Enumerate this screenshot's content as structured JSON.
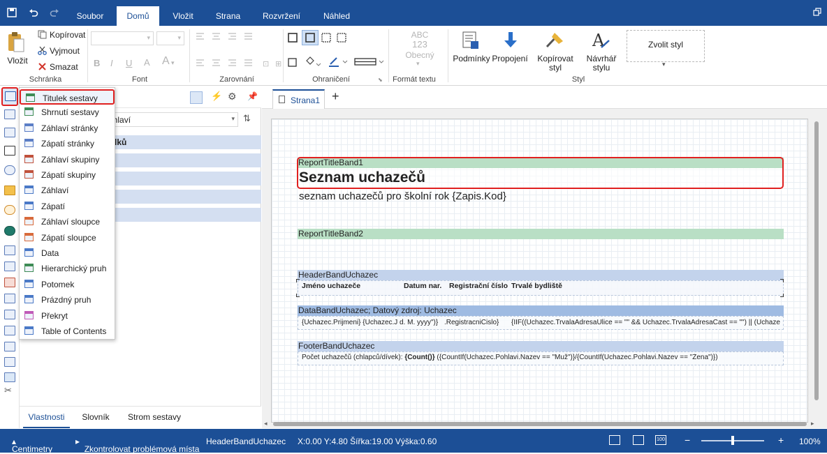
{
  "window": {
    "tabs": [
      "Soubor",
      "Domů",
      "Vložit",
      "Strana",
      "Rozvržení",
      "Náhled"
    ],
    "active_tab": "Domů"
  },
  "ribbon": {
    "clipboard": {
      "paste": "Vložit",
      "copy": "Kopírovat",
      "cut": "Vyjmout",
      "delete": "Smazat",
      "label": "Schránka"
    },
    "font": {
      "label": "Font"
    },
    "alignment": {
      "label": "Zarovnání"
    },
    "borders": {
      "label": "Ohraničení"
    },
    "text_format": {
      "abc": "ABC",
      "num": "123",
      "value": "Obecný",
      "label": "Formát textu"
    },
    "style": {
      "headers": "Podmínky",
      "joins": "Propojení",
      "copy_style": "Kopírovat styl",
      "designer_1": "Návrhář",
      "designer_2": "stylu",
      "choose": "Zvolit styl",
      "label": "Styl"
    }
  },
  "panel": {
    "search_value": "áhlaví",
    "group_title": "dků",
    "bottom_tabs": [
      "Vlastnosti",
      "Slovník",
      "Strom sestavy"
    ],
    "active_bottom_tab": "Vlastnosti"
  },
  "bands_menu": [
    {
      "label": "Titulek sestavy",
      "icon": "report-title-icon",
      "highlighted": true,
      "color": "#3e8b55"
    },
    {
      "label": "Shrnutí sestavy",
      "icon": "report-summary-icon",
      "color": "#3e8b55"
    },
    {
      "label": "Záhlaví stránky",
      "icon": "page-header-icon",
      "color": "#5b7ec6"
    },
    {
      "label": "Zápatí stránky",
      "icon": "page-footer-icon",
      "color": "#5b7ec6"
    },
    {
      "label": "Záhlaví skupiny",
      "icon": "group-header-icon",
      "color": "#c0513c"
    },
    {
      "label": "Zápatí skupiny",
      "icon": "group-footer-icon",
      "color": "#c0513c"
    },
    {
      "label": "Záhlaví",
      "icon": "header-icon",
      "color": "#4a79c7"
    },
    {
      "label": "Zápatí",
      "icon": "footer-icon",
      "color": "#4a79c7"
    },
    {
      "label": "Záhlaví sloupce",
      "icon": "column-header-icon",
      "color": "#d86a3b"
    },
    {
      "label": "Zápatí sloupce",
      "icon": "column-footer-icon",
      "color": "#d86a3b"
    },
    {
      "label": "Data",
      "icon": "data-icon",
      "color": "#4a79c7"
    },
    {
      "label": "Hierarchický pruh",
      "icon": "hierarchical-band-icon",
      "color": "#3e8b55"
    },
    {
      "label": "Potomek",
      "icon": "child-band-icon",
      "color": "#4a79c7"
    },
    {
      "label": "Prázdný pruh",
      "icon": "empty-band-icon",
      "color": "#4a79c7"
    },
    {
      "label": "Překryt",
      "icon": "overlay-icon",
      "color": "#c05ab8"
    },
    {
      "label": "Table of Contents",
      "icon": "toc-icon",
      "color": "#4a79c7"
    }
  ],
  "designer": {
    "page_tab": "Strana1",
    "add_tab": "+",
    "bands": {
      "title1_name": "ReportTitleBand1",
      "title_text": "Seznam uchazečů",
      "subtitle_text": "seznam uchazečů pro školní rok {Zapis.Kod}",
      "title2_name": "ReportTitleBand2",
      "header_name": "HeaderBandUchazec",
      "header_cols": [
        "Jméno uchazeče",
        "Datum nar.",
        "Registrační číslo",
        "Trvalé bydliště"
      ],
      "data_name": "DataBandUchazec; Datový zdroj: Uchazec",
      "data_cols": [
        "{Uchazec.Prijmeni} {Uchazec.J",
        "d. M. yyyy\")}",
        ".RegistracniCislo}",
        "{IIF((Uchazec.TrvalaAdresaUlice == \"\" && Uchazec.TrvalaAdresaCast == \"\") || (Uchaze"
      ],
      "footer_name": "FooterBandUchazec",
      "footer_prefix": "Počet uchazečů (chlapců/dívek):",
      "footer_count": "{Count()}",
      "footer_expr": "({CountIf(Uchazec.Pohlavi.Nazev == \"Muž\")}/{CountIf(Uchazec.Pohlavi.Nazev == \"Žena\")})"
    }
  },
  "statusbar": {
    "units": "Centimetry",
    "check": "Zkontrolovat problémová místa",
    "component": "HeaderBandUchazec",
    "position": "X:0.00 Y:4.80 Šířka:19.00 Výška:0.60",
    "zoom": "100%",
    "zoom_minus": "−",
    "zoom_plus": "+",
    "zoom_level": 0.5
  },
  "colors": {
    "brand": "#1c4f96",
    "title_band": "#b9dfc5",
    "header_band": "#c3d3ec",
    "data_band": "#9fbbe2",
    "highlight": "#e02020"
  }
}
